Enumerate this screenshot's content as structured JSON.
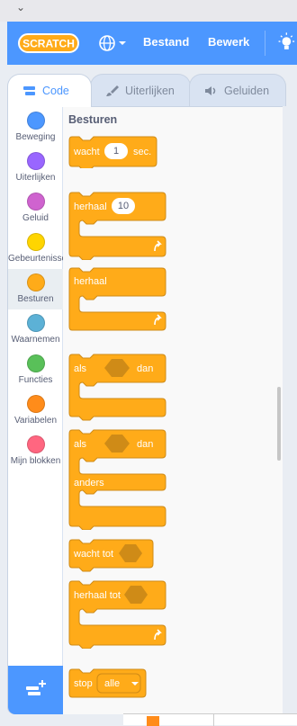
{
  "menubar": {
    "logo_text": "SCRATCH",
    "file_label": "Bestand",
    "edit_label": "Bewerk"
  },
  "tabs": [
    {
      "label": "Code"
    },
    {
      "label": "Uiterlijken"
    },
    {
      "label": "Geluiden"
    }
  ],
  "categories": [
    {
      "label": "Beweging",
      "color": "#4c97ff"
    },
    {
      "label": "Uiterlijken",
      "color": "#9966ff"
    },
    {
      "label": "Geluid",
      "color": "#cf63cf"
    },
    {
      "label": "Gebeurtenissen",
      "color": "#ffd500"
    },
    {
      "label": "Besturen",
      "color": "#ffab19"
    },
    {
      "label": "Waarnemen",
      "color": "#5cb1d6"
    },
    {
      "label": "Functies",
      "color": "#59c059"
    },
    {
      "label": "Variabelen",
      "color": "#ff8c1a"
    },
    {
      "label": "Mijn blokken",
      "color": "#ff6680"
    }
  ],
  "palette": {
    "title": "Besturen",
    "blocks": {
      "wait": {
        "text": "wacht",
        "value": "1",
        "unit": "sec."
      },
      "repeat": {
        "text": "herhaal",
        "value": "10"
      },
      "forever": {
        "text": "herhaal"
      },
      "if_then": {
        "if": "als",
        "then": "dan"
      },
      "if_else": {
        "if": "als",
        "then": "dan",
        "else": "anders"
      },
      "wait_until": {
        "text": "wacht tot"
      },
      "repeat_until": {
        "text": "herhaal tot"
      },
      "stop": {
        "text": "stop",
        "option": "alle"
      }
    }
  },
  "colors": {
    "control": "#ffab19",
    "control_dark": "#cf8b17",
    "accent": "#4c97ff"
  }
}
